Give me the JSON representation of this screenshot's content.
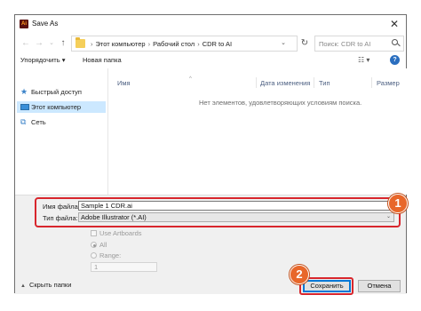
{
  "window": {
    "title": "Save As",
    "app_icon_text": "Ai"
  },
  "address": {
    "crumbs": [
      "Этот компьютер",
      "Рабочий стол",
      "CDR to AI"
    ],
    "search_placeholder": "Поиск: CDR to AI"
  },
  "toolbar": {
    "organize": "Упорядочить ▾",
    "new_folder": "Новая папка",
    "help": "?"
  },
  "nav_pane": {
    "items": [
      {
        "label": "Быстрый доступ",
        "icon": "star-icon"
      },
      {
        "label": "Этот компьютер",
        "icon": "computer-icon"
      },
      {
        "label": "Сеть",
        "icon": "network-icon"
      }
    ]
  },
  "file_list": {
    "columns": [
      "Имя",
      "Дата изменения",
      "Тип",
      "Размер"
    ],
    "empty_message": "Нет элементов, удовлетворяющих условиям поиска."
  },
  "form": {
    "filename_label": "Имя файла:",
    "filename_value": "Sample 1 CDR.ai",
    "filetype_label": "Тип файла:",
    "filetype_value": "Adobe Illustrator (*.AI)",
    "use_artboards": "Use Artboards",
    "all": "All",
    "range": "Range:",
    "range_value": "1"
  },
  "footer": {
    "hide_folders": "Скрыть папки",
    "save": "Сохранить",
    "cancel": "Отмена"
  },
  "annotations": {
    "badge1": "1",
    "badge2": "2"
  },
  "colors": {
    "accent": "#0078d7",
    "highlight": "#d8262d",
    "badge": "#e8672a",
    "selected": "#cce8ff"
  }
}
